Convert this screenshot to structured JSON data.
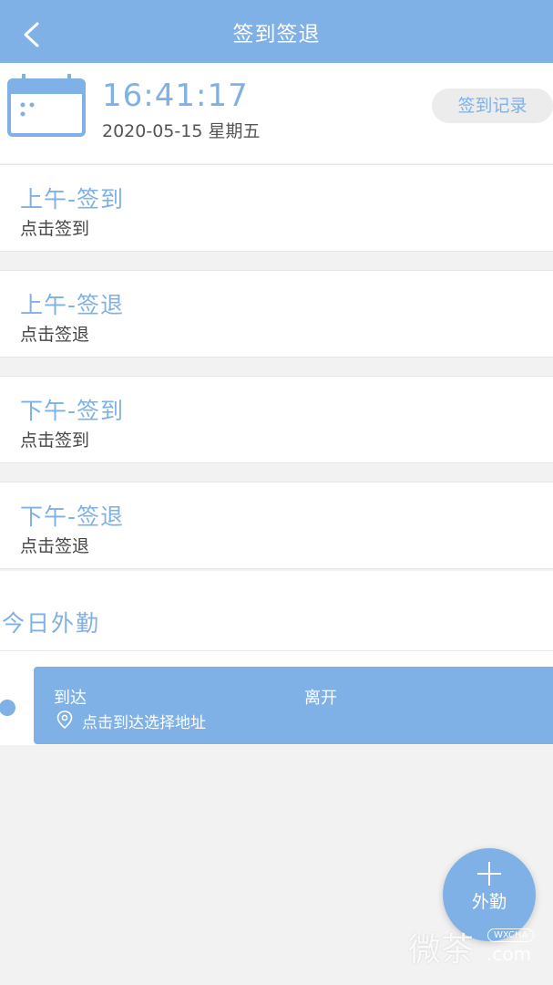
{
  "header": {
    "title": "签到签退",
    "back_icon": "chevron-left-icon"
  },
  "clock": {
    "time": "16:41:17",
    "date": "2020-05-15 星期五",
    "record_button": "签到记录",
    "calendar_icon": "calendar-icon"
  },
  "cards": [
    {
      "title": "上午-签到",
      "subtitle": "点击签到"
    },
    {
      "title": "上午-签退",
      "subtitle": "点击签退"
    },
    {
      "title": "下午-签到",
      "subtitle": "点击签到"
    },
    {
      "title": "下午-签退",
      "subtitle": "点击签退"
    }
  ],
  "outing": {
    "section_title": "今日外勤",
    "arrive_label": "到达",
    "leave_label": "离开",
    "address_prompt": "点击到达选择地址",
    "location_icon": "location-pin-icon"
  },
  "fab": {
    "label": "外勤",
    "icon": "plus-icon"
  },
  "watermark": {
    "text": "微茶",
    "badge": "WXCHA",
    "domain": ".com"
  },
  "colors": {
    "accent": "#7fb1e6",
    "background": "#f2f2f2",
    "card": "#ffffff"
  }
}
